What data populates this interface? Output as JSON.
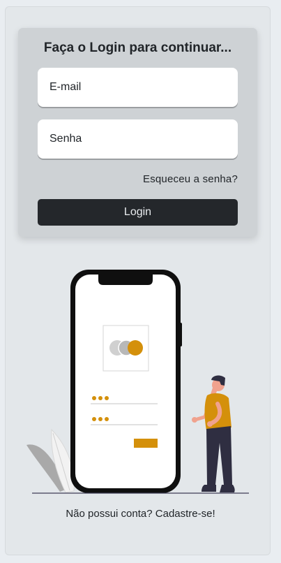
{
  "login": {
    "title": "Faça o Login para continuar...",
    "email_placeholder": "E-mail",
    "password_placeholder": "Senha",
    "forgot_label": "Esqueceu a senha?",
    "submit_label": "Login"
  },
  "signup": {
    "prompt": "Não possui conta?",
    "link_label": "Cadastre-se!"
  },
  "illustration": {
    "accent_color": "#d4900b",
    "icons": [
      "smartphone-illustration",
      "person-illustration",
      "leaf-plant-illustration"
    ]
  }
}
